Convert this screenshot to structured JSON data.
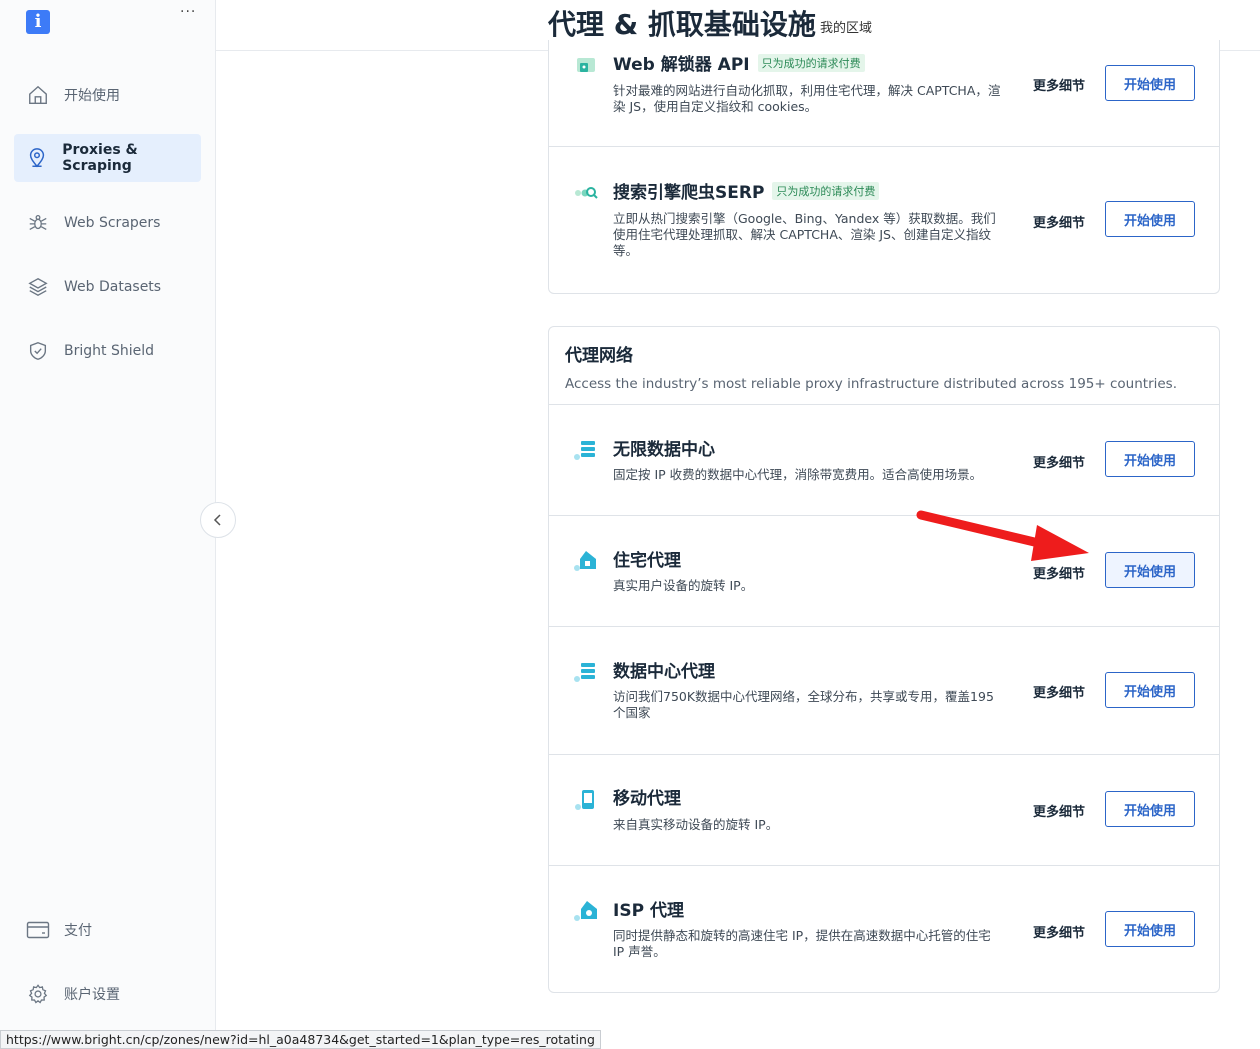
{
  "sidebar": {
    "logo_glyph": "i",
    "more": "···",
    "items": [
      {
        "label": "开始使用",
        "icon": "home-icon"
      },
      {
        "label": "Proxies & Scraping",
        "icon": "location-pin-icon",
        "active": true
      },
      {
        "label": "Web Scrapers",
        "icon": "spider-icon"
      },
      {
        "label": "Web Datasets",
        "icon": "layers-icon"
      },
      {
        "label": "Bright Shield",
        "icon": "shield-icon"
      }
    ],
    "bottom_items": [
      {
        "label": "支付",
        "icon": "credit-card-icon"
      },
      {
        "label": "账户设置",
        "icon": "gear-icon"
      }
    ]
  },
  "header": {
    "title": "代理 & 抓取基础设施",
    "zone_link": "我的区域"
  },
  "scraping_card": {
    "rows": [
      {
        "title": "Web 解锁器 API",
        "badge": "只为成功的请求付费",
        "desc": "针对最难的网站进行自动化抓取，利用住宅代理，解决 CAPTCHA，渲染 JS，使用自定义指纹和 cookies。",
        "details": "更多细节",
        "start": "开始使用",
        "icon": "unlocker-icon"
      },
      {
        "title": "搜索引擎爬虫SERP",
        "badge": "只为成功的请求付费",
        "desc": "立即从热门搜索引擎（Google、Bing、Yandex 等）获取数据。我们使用住宅代理处理抓取、解决 CAPTCHA、渲染 JS、创建自定义指纹等。",
        "details": "更多细节",
        "start": "开始使用",
        "icon": "search-engine-icon"
      }
    ]
  },
  "proxy_card": {
    "title": "代理网络",
    "subtitle": "Access the industry’s most reliable proxy infrastructure distributed across 195+ countries.",
    "rows": [
      {
        "title": "无限数据中心",
        "desc": "固定按 IP 收费的数据中心代理，消除带宽费用。适合高使用场景。",
        "details": "更多细节",
        "start": "开始使用",
        "icon": "server-icon"
      },
      {
        "title": "住宅代理",
        "desc": "真实用户设备的旋转 IP。",
        "details": "更多细节",
        "start": "开始使用",
        "icon": "house-icon"
      },
      {
        "title": "数据中心代理",
        "desc": "访问我们750K数据中心代理网络，全球分布，共享或专用，覆盖195个国家",
        "details": "更多细节",
        "start": "开始使用",
        "icon": "server-icon"
      },
      {
        "title": "移动代理",
        "desc": "来自真实移动设备的旋转 IP。",
        "details": "更多细节",
        "start": "开始使用",
        "icon": "mobile-icon"
      },
      {
        "title": "ISP 代理",
        "desc": "同时提供静态和旋转的高速住宅 IP，提供在高速数据中心托管的住宅 IP 声誉。",
        "details": "更多细节",
        "start": "开始使用",
        "icon": "isp-house-icon"
      }
    ]
  },
  "status_url": "https://www.bright.cn/cp/zones/new?id=hl_a0a48734&get_started=1&plan_type=res_rotating",
  "colors": {
    "accent": "#2c65c8",
    "active_bg": "#e5effd",
    "badge_green": "#2c8a57",
    "icon_teal": "#2bb3d6",
    "arrow_red": "#ee1c1c"
  }
}
